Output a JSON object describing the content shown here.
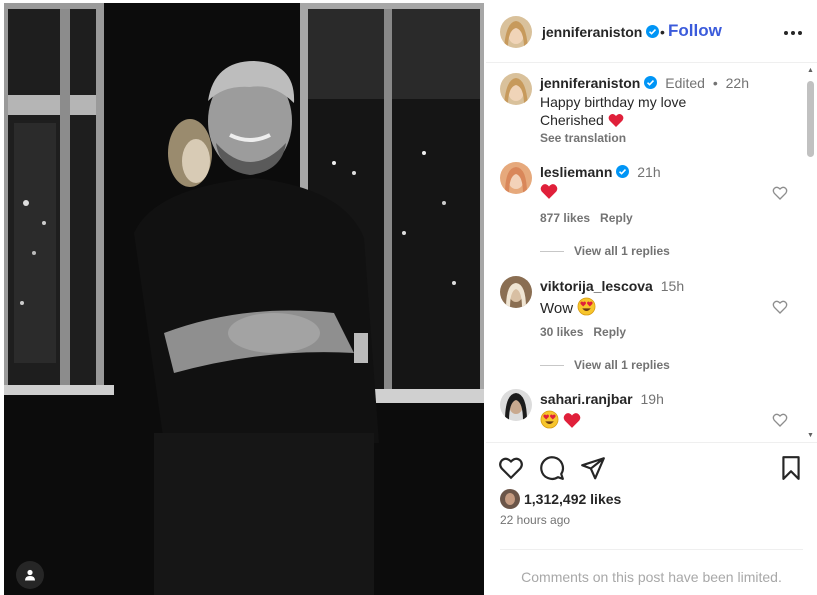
{
  "post": {
    "author": "jenniferaniston",
    "follow_label": "Follow",
    "separator": "•"
  },
  "caption": {
    "user": "jenniferaniston",
    "edited": "Edited",
    "bullet": "•",
    "time": "22h",
    "line1": "Happy birthday my love",
    "line2": "Cherished",
    "see_translation": "See translation"
  },
  "comments": [
    {
      "user": "lesliemann",
      "verified": true,
      "time": "21h",
      "likes": "877 likes",
      "reply": "Reply",
      "view_replies": "View all 1 replies"
    },
    {
      "user": "viktorija_lescova",
      "verified": false,
      "time": "15h",
      "text": "Wow",
      "likes": "30 likes",
      "reply": "Reply",
      "view_replies": "View all 1 replies"
    },
    {
      "user": "sahari.ranjbar",
      "verified": false,
      "time": "19h"
    }
  ],
  "footer": {
    "likes_count": "1,312,492 likes",
    "time_ago": "22 hours ago",
    "comments_limited": "Comments on this post have been limited."
  },
  "icons": {
    "verified": "verified-badge-icon",
    "more": "more-options-icon",
    "like": "heart-icon",
    "comment": "comment-icon",
    "share": "share-icon",
    "save": "bookmark-icon",
    "tag": "user-tag-icon"
  },
  "colors": {
    "follow": "#3b5bdb",
    "verified": "#0095f6",
    "heart_red": "#e0203a",
    "muted": "#737373"
  }
}
